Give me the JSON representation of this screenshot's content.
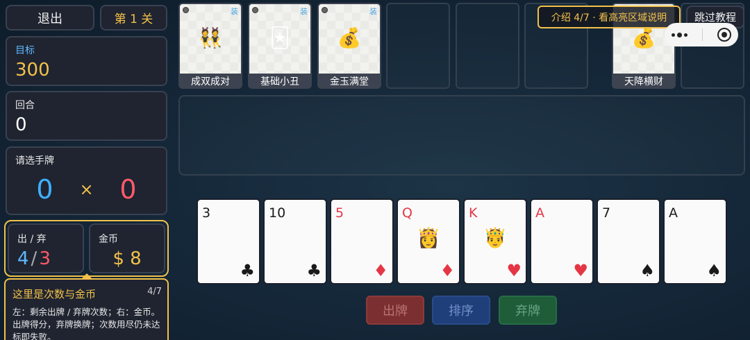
{
  "top_left": {
    "exit_label": "退出",
    "stage_label": "第 1 关"
  },
  "target": {
    "label": "目标",
    "value": "300"
  },
  "round": {
    "label": "回合",
    "value": "0"
  },
  "selection": {
    "label": "请选手牌",
    "chips": "0",
    "times": "×",
    "mult": "0"
  },
  "hands_discards": {
    "label": "出 / 弃",
    "hands": "4",
    "slash": "/",
    "discards": "3"
  },
  "gold": {
    "label": "金币",
    "value": "$ 8"
  },
  "tip": {
    "title": "这里是次数与金币",
    "step": "4/7",
    "body": "左：剩余出牌 / 弃牌次数；右：金币。出牌得分，弃牌换牌；次数用尽仍未达标即失败。"
  },
  "jokers": [
    {
      "name": "成双成对",
      "tag": "装",
      "emoji": "👯"
    },
    {
      "name": "基础小丑",
      "tag": "装",
      "emoji": "🃏"
    },
    {
      "name": "金玉满堂",
      "tag": "装",
      "emoji": "💰"
    }
  ],
  "shop_joker": {
    "name": "天降横财",
    "emoji": "💰"
  },
  "intro": {
    "label": "介绍 4/7 · 看高亮区域说明"
  },
  "skip": {
    "label": "跳过教程"
  },
  "hand": [
    {
      "rank": "3",
      "suit": "♣",
      "color": "black"
    },
    {
      "rank": "10",
      "suit": "♣",
      "color": "black"
    },
    {
      "rank": "5",
      "suit": "♦",
      "color": "red"
    },
    {
      "rank": "Q",
      "suit": "♦",
      "color": "red",
      "face": "👸"
    },
    {
      "rank": "K",
      "suit": "♥",
      "color": "red",
      "face": "🤴"
    },
    {
      "rank": "A",
      "suit": "♥",
      "color": "red"
    },
    {
      "rank": "7",
      "suit": "♠",
      "color": "black"
    },
    {
      "rank": "A",
      "suit": "♠",
      "color": "black"
    }
  ],
  "actions": {
    "play": "出牌",
    "sort": "排序",
    "discard": "弃牌"
  }
}
